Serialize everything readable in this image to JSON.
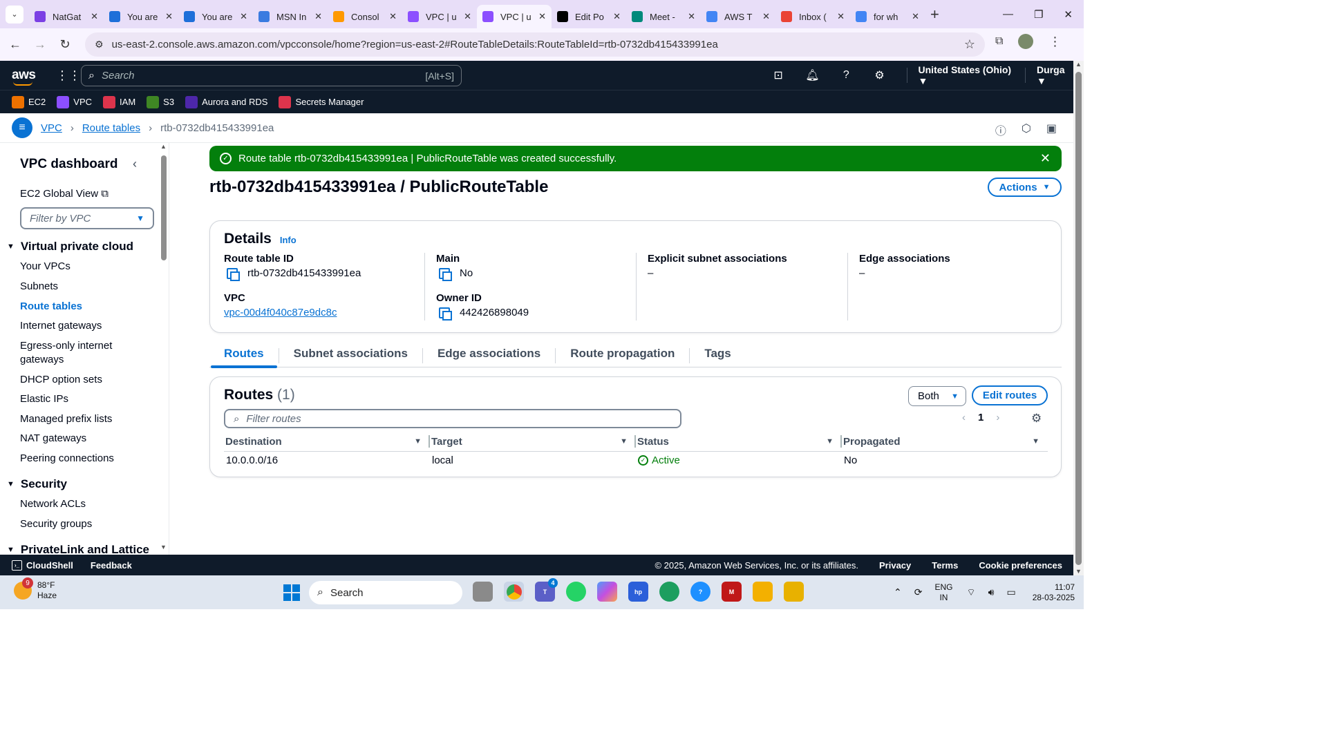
{
  "browser": {
    "tabs": [
      {
        "label": "NatGat",
        "fav_color": "#7b3fe4",
        "active": false
      },
      {
        "label": "You are",
        "fav_color": "#1e6fd9",
        "active": false
      },
      {
        "label": "You are",
        "fav_color": "#1e6fd9",
        "active": false
      },
      {
        "label": "MSN In",
        "fav_color": "#3a7be0",
        "active": false
      },
      {
        "label": "Consol",
        "fav_color": "#ff9900",
        "active": false
      },
      {
        "label": "VPC | u",
        "fav_color": "#8c4fff",
        "active": false
      },
      {
        "label": "VPC | u",
        "fav_color": "#8c4fff",
        "active": true
      },
      {
        "label": "Edit Po",
        "fav_color": "#000000",
        "active": false
      },
      {
        "label": "Meet -",
        "fav_color": "#00897b",
        "active": false
      },
      {
        "label": "AWS T",
        "fav_color": "#4285f4",
        "active": false
      },
      {
        "label": "Inbox (",
        "fav_color": "#ea4335",
        "active": false
      },
      {
        "label": "for wh",
        "fav_color": "#4285f4",
        "active": false
      }
    ],
    "url": "us-east-2.console.aws.amazon.com/vpcconsole/home?region=us-east-2#RouteTableDetails:RouteTableId=rtb-0732db415433991ea"
  },
  "awsnav": {
    "logo": "aws",
    "search_placeholder": "Search",
    "search_shortcut": "[Alt+S]",
    "region": "United States (Ohio) ▼",
    "user": "Durga ▼"
  },
  "favorites": [
    {
      "label": "EC2",
      "color": "#ed7100"
    },
    {
      "label": "VPC",
      "color": "#8c4fff"
    },
    {
      "label": "IAM",
      "color": "#dd344c"
    },
    {
      "label": "S3",
      "color": "#3f8624"
    },
    {
      "label": "Aurora and RDS",
      "color": "#4d27aa"
    },
    {
      "label": "Secrets Manager",
      "color": "#dd344c"
    }
  ],
  "breadcrumb": {
    "items": [
      "VPC",
      "Route tables"
    ],
    "current": "rtb-0732db415433991ea"
  },
  "sidebar": {
    "title": "VPC dashboard",
    "ec2_global_view": "EC2 Global View",
    "filter_placeholder": "Filter by VPC",
    "sections": [
      {
        "title": "Virtual private cloud",
        "items": [
          "Your VPCs",
          "Subnets",
          "Route tables",
          "Internet gateways",
          "Egress-only internet gateways",
          "DHCP option sets",
          "Elastic IPs",
          "Managed prefix lists",
          "NAT gateways",
          "Peering connections"
        ]
      },
      {
        "title": "Security",
        "items": [
          "Network ACLs",
          "Security groups"
        ]
      },
      {
        "title": "PrivateLink and Lattice",
        "items": []
      }
    ],
    "active_item": "Route tables"
  },
  "flash": {
    "message": "Route table rtb-0732db415433991ea | PublicRouteTable was created successfully."
  },
  "page": {
    "title": "rtb-0732db415433991ea / PublicRouteTable",
    "actions_label": "Actions"
  },
  "details": {
    "header": "Details",
    "info": "Info",
    "route_table_id_label": "Route table ID",
    "route_table_id": "rtb-0732db415433991ea",
    "vpc_label": "VPC",
    "vpc": "vpc-00d4f040c87e9dc8c",
    "main_label": "Main",
    "main": "No",
    "owner_label": "Owner ID",
    "owner": "442426898049",
    "explicit_label": "Explicit subnet associations",
    "explicit": "–",
    "edge_label": "Edge associations",
    "edge": "–"
  },
  "tabs": [
    "Routes",
    "Subnet associations",
    "Edge associations",
    "Route propagation",
    "Tags"
  ],
  "routes": {
    "title": "Routes",
    "count": "(1)",
    "both_label": "Both",
    "edit_label": "Edit routes",
    "filter_placeholder": "Filter routes",
    "page": "1",
    "columns": [
      "Destination",
      "Target",
      "Status",
      "Propagated"
    ],
    "rows": [
      {
        "destination": "10.0.0.0/16",
        "target": "local",
        "status": "Active",
        "propagated": "No"
      }
    ]
  },
  "footer": {
    "cloudshell": "CloudShell",
    "feedback": "Feedback",
    "copyright": "© 2025, Amazon Web Services, Inc. or its affiliates.",
    "privacy": "Privacy",
    "terms": "Terms",
    "cookies": "Cookie preferences"
  },
  "taskbar": {
    "weather_temp": "88°F",
    "weather_desc": "Haze",
    "weather_badge": "9",
    "search": "Search",
    "teams_count": "4",
    "lang": "ENG",
    "region": "IN",
    "time": "11:07",
    "date": "28-03-2025"
  }
}
